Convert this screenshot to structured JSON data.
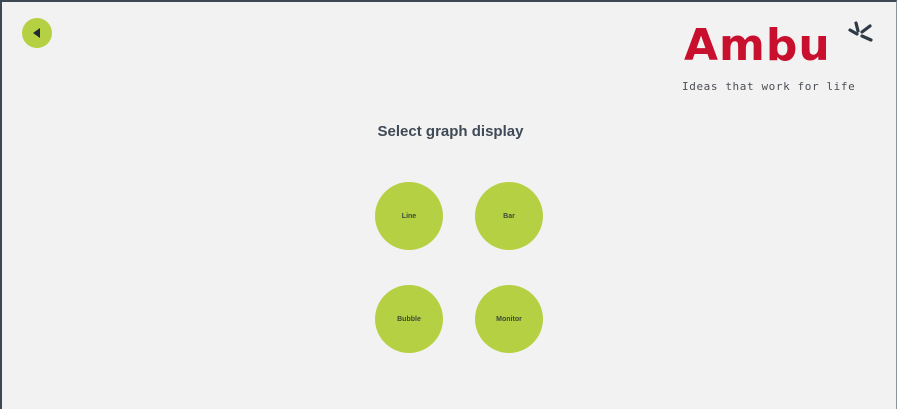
{
  "app": {
    "back_icon": "back-arrow-icon",
    "accent_color": "#b6d043",
    "brand_color": "#c8102e"
  },
  "logo": {
    "wordmark": "Ambu",
    "tagline": "Ideas that work for life"
  },
  "main": {
    "title": "Select graph display",
    "options": [
      {
        "label": "Line"
      },
      {
        "label": "Bar"
      },
      {
        "label": "Bubble"
      },
      {
        "label": "Monitor"
      }
    ]
  }
}
